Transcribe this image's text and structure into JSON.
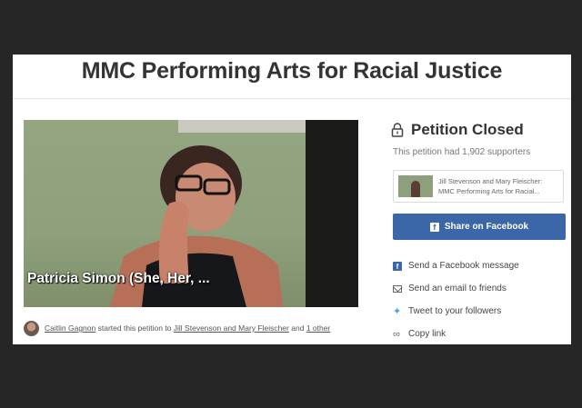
{
  "page_title": "MMC Performing Arts for Racial Justice",
  "video": {
    "caption": "Patricia Simon (She, Her, ..."
  },
  "starter": {
    "author": "Caitlin Gagnon",
    "text_mid": "started this petition to",
    "recipients": "Jill Stevenson and Mary Fleischer",
    "text_and": "and",
    "other": "1 other"
  },
  "status": {
    "label": "Petition Closed",
    "icon": "lock-icon"
  },
  "supporters_text": "This petition had 1,902 supporters",
  "share_card": {
    "line1": "Jill Stevenson and Mary Fleischer:",
    "line2": "MMC Performing Arts for Racial..."
  },
  "facebook_button": {
    "label": "Share on Facebook",
    "color": "#3b66a8"
  },
  "share_options": [
    {
      "icon": "facebook-icon",
      "label": "Send a Facebook message"
    },
    {
      "icon": "email-icon",
      "label": "Send an email to friends"
    },
    {
      "icon": "twitter-icon",
      "label": "Tweet to your followers"
    },
    {
      "icon": "link-icon",
      "label": "Copy link"
    }
  ]
}
